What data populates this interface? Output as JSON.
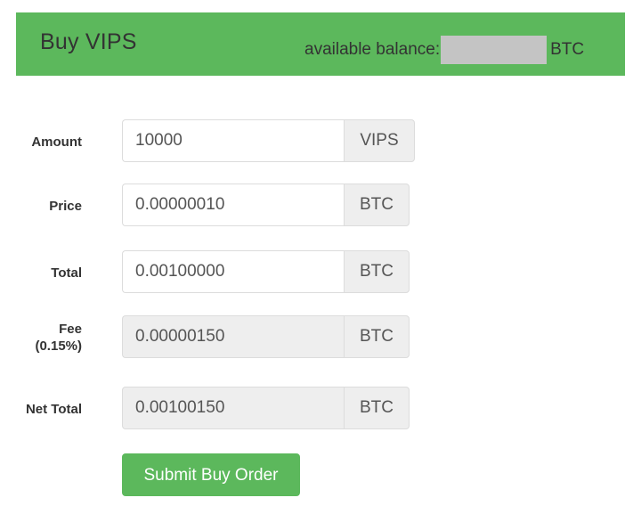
{
  "header": {
    "title": "Buy VIPS",
    "balance_label": "available balance:",
    "balance_value": "",
    "balance_unit": "BTC",
    "background_color": "#5cb85c",
    "title_color": "#333333",
    "redaction_color": "#c4c4c4"
  },
  "form": {
    "rows": [
      {
        "label": "Amount",
        "sub_label": "",
        "value": "10000",
        "unit": "VIPS",
        "disabled": false
      },
      {
        "label": "Price",
        "sub_label": "",
        "value": "0.00000010",
        "unit": "BTC",
        "disabled": false
      },
      {
        "label": "Total",
        "sub_label": "",
        "value": "0.00100000",
        "unit": "BTC",
        "disabled": false
      },
      {
        "label": "Fee",
        "sub_label": "(0.15%)",
        "value": "0.00000150",
        "unit": "BTC",
        "disabled": true
      },
      {
        "label": "Net Total",
        "sub_label": "",
        "value": "0.00100150",
        "unit": "BTC",
        "disabled": true
      }
    ],
    "submit_label": "Submit Buy Order",
    "submit_color": "#5cb85c"
  }
}
